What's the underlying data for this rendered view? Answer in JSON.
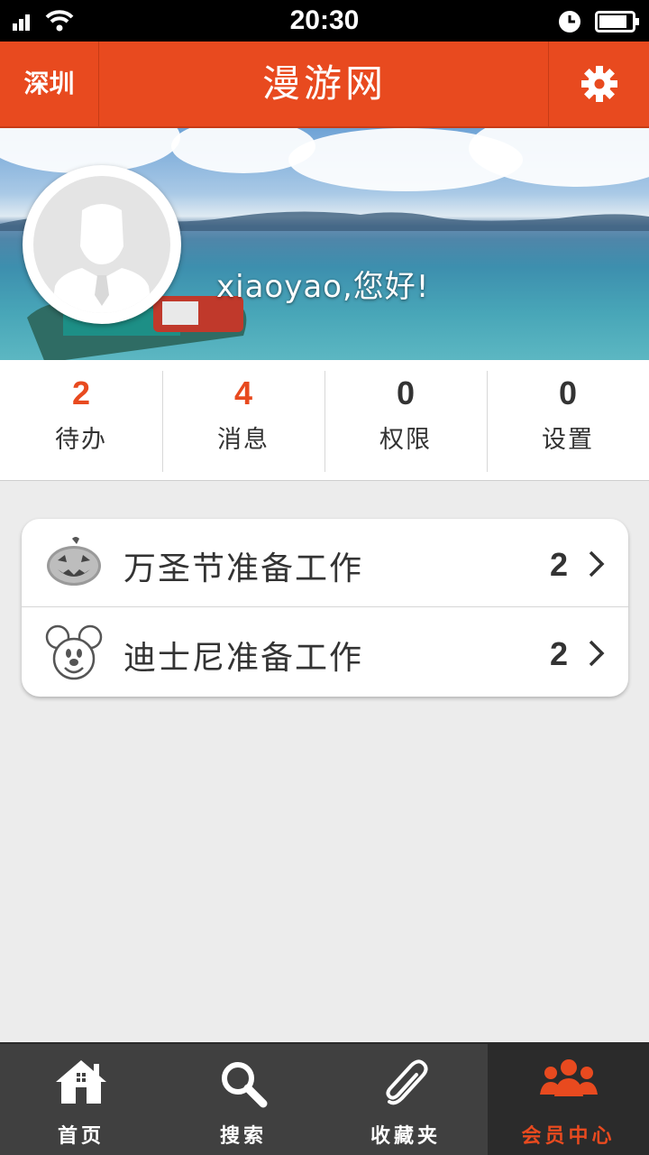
{
  "status_bar": {
    "time": "20:30"
  },
  "header": {
    "city": "深圳",
    "title": "漫游网",
    "settings_icon": "gear-icon"
  },
  "profile": {
    "greeting": "xiaoyao,您好!",
    "avatar_icon": "user-avatar-icon"
  },
  "stats": [
    {
      "value": "2",
      "label": "待办",
      "highlight": true
    },
    {
      "value": "4",
      "label": "消息",
      "highlight": true
    },
    {
      "value": "0",
      "label": "权限",
      "highlight": false
    },
    {
      "value": "0",
      "label": "设置",
      "highlight": false
    }
  ],
  "list": [
    {
      "icon": "pumpkin-icon",
      "label": "万圣节准备工作",
      "count": "2"
    },
    {
      "icon": "mickey-icon",
      "label": "迪士尼准备工作",
      "count": "2"
    }
  ],
  "tabs": [
    {
      "icon": "home-icon",
      "label": "首页",
      "active": false
    },
    {
      "icon": "search-icon",
      "label": "搜索",
      "active": false
    },
    {
      "icon": "paperclip-icon",
      "label": "收藏夹",
      "active": false
    },
    {
      "icon": "members-icon",
      "label": "会员中心",
      "active": true
    }
  ],
  "colors": {
    "accent": "#e84a1f",
    "tabbar": "#404040",
    "background": "#ececec"
  }
}
